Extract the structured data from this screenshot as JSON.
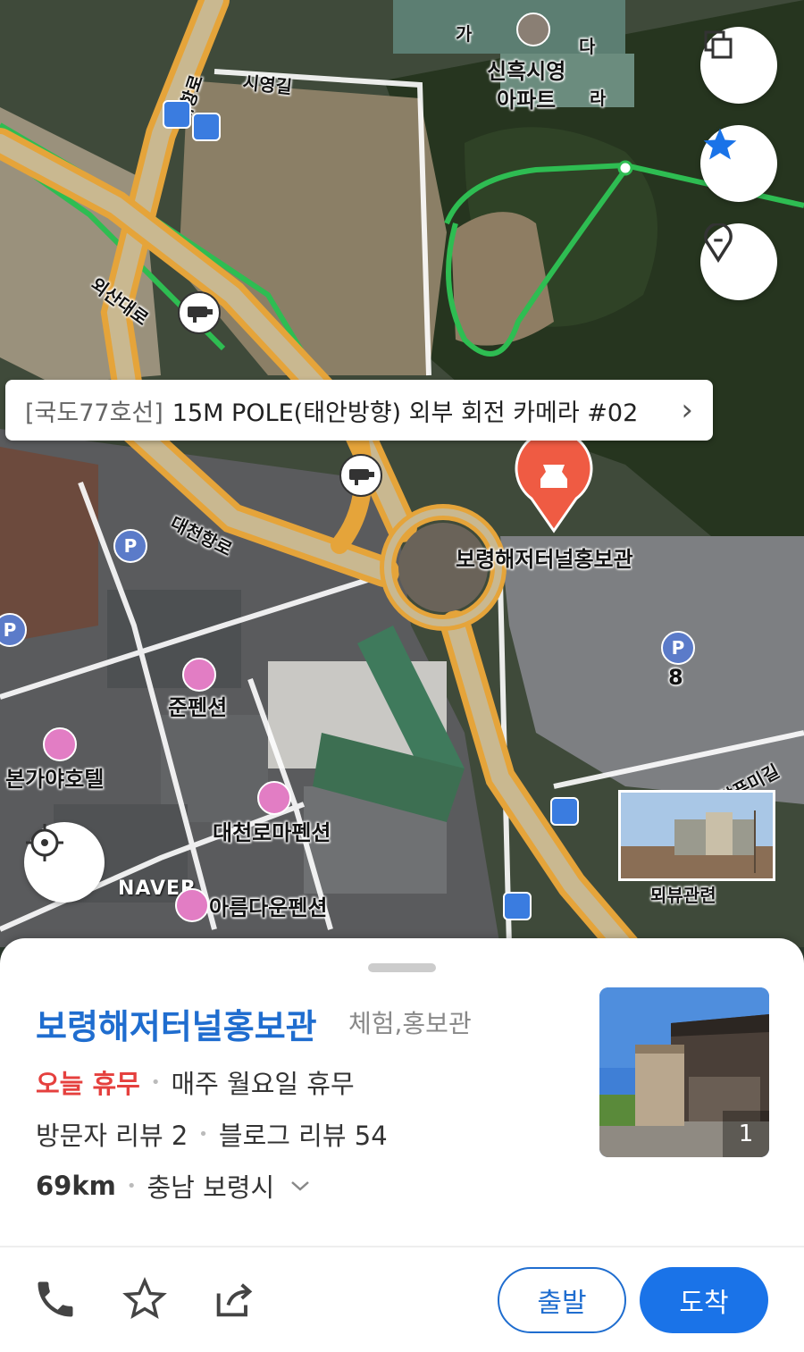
{
  "map": {
    "labels": {
      "apartment_line1": "신흑시영",
      "apartment_line2": "아파트",
      "block_ga": "가",
      "block_da": "다",
      "block_ra": "라",
      "siyeong_gil": "시영길",
      "daehang_ro_top": "대항로",
      "waesan_daero": "외산대로",
      "daecheon_hang_ro": "대천항로",
      "poi_name": "보령해저터널홍보관",
      "junpension": "준펜션",
      "bongaya_hotel": "본가야호텔",
      "daecheon_roma": "대천로마펜션",
      "areumdaun": "아름다운펜션",
      "dalpumi_gil": "달푸미길",
      "parking_8": "8",
      "naver": "NAVER",
      "photo_caption": "뫼뷰관련",
      "parking_p": "P"
    },
    "camera_banner": {
      "category": "[국도77호선]",
      "title": "15M POLE(태안방향) 외부 회전 카메라 #02",
      "chevron": "›"
    },
    "buttons": {
      "layers": "layers-icon",
      "favorite": "star-icon",
      "location_pin": "pin-icon",
      "gps": "crosshair-icon"
    },
    "colors": {
      "road": "#e5a43a",
      "road_center": "#c9b890",
      "green_road": "#2ebd52",
      "marker": "#ef5b43",
      "accent": "#1a73e8"
    }
  },
  "sheet": {
    "title": "보령해저터널홍보관",
    "category": "체험,홍보관",
    "status_closed": "오늘 휴무",
    "status_detail": "매주 월요일 휴무",
    "visitor_reviews": "방문자 리뷰 2",
    "blog_reviews": "블로그 리뷰 54",
    "distance": "69km",
    "region": "충남 보령시",
    "photo_count": "1",
    "start_button": "출발",
    "arrive_button": "도착",
    "icons": [
      "phone-icon",
      "star-outline-icon",
      "share-icon"
    ]
  }
}
